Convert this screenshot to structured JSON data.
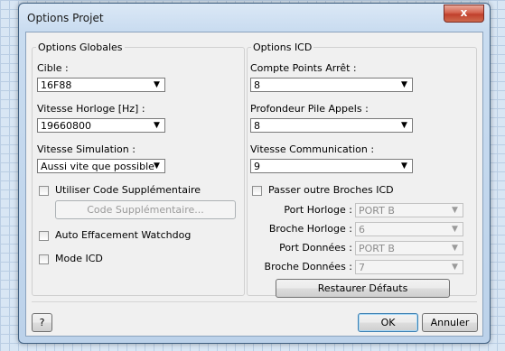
{
  "window": {
    "title": "Options Projet",
    "close_glyph": "x"
  },
  "global": {
    "legend": "Options Globales",
    "target": {
      "label": "Cible :",
      "value": "16F88"
    },
    "clock": {
      "label": "Vitesse Horloge [Hz] :",
      "value": "19660800"
    },
    "sim_speed": {
      "label": "Vitesse Simulation :",
      "value": "Aussi vite que possible"
    },
    "extra_code": {
      "checkbox_label": "Utiliser Code Supplémentaire",
      "checked": false,
      "button_label": "Code Supplémentaire..."
    },
    "watchdog": {
      "label": "Auto Effacement Watchdog",
      "checked": false
    },
    "icd_mode": {
      "label": "Mode ICD",
      "checked": false
    }
  },
  "icd": {
    "legend": "Options ICD",
    "breakpoints": {
      "label": "Compte Points Arrêt :",
      "value": "8"
    },
    "stack_depth": {
      "label": "Profondeur Pile Appels :",
      "value": "8"
    },
    "comm_speed": {
      "label": "Vitesse Communication :",
      "value": "9"
    },
    "bypass_pins": {
      "label": "Passer outre Broches ICD",
      "checked": false
    },
    "clock_port": {
      "label": "Port Horloge :",
      "value": "PORT B"
    },
    "clock_pin": {
      "label": "Broche Horloge :",
      "value": "6"
    },
    "data_port": {
      "label": "Port Données :",
      "value": "PORT B"
    },
    "data_pin": {
      "label": "Broche Données :",
      "value": "7"
    },
    "restore_label": "Restaurer Défauts"
  },
  "footer": {
    "help_label": "?",
    "ok_label": "OK",
    "cancel_label": "Annuler"
  },
  "arrow_glyph": "▼"
}
